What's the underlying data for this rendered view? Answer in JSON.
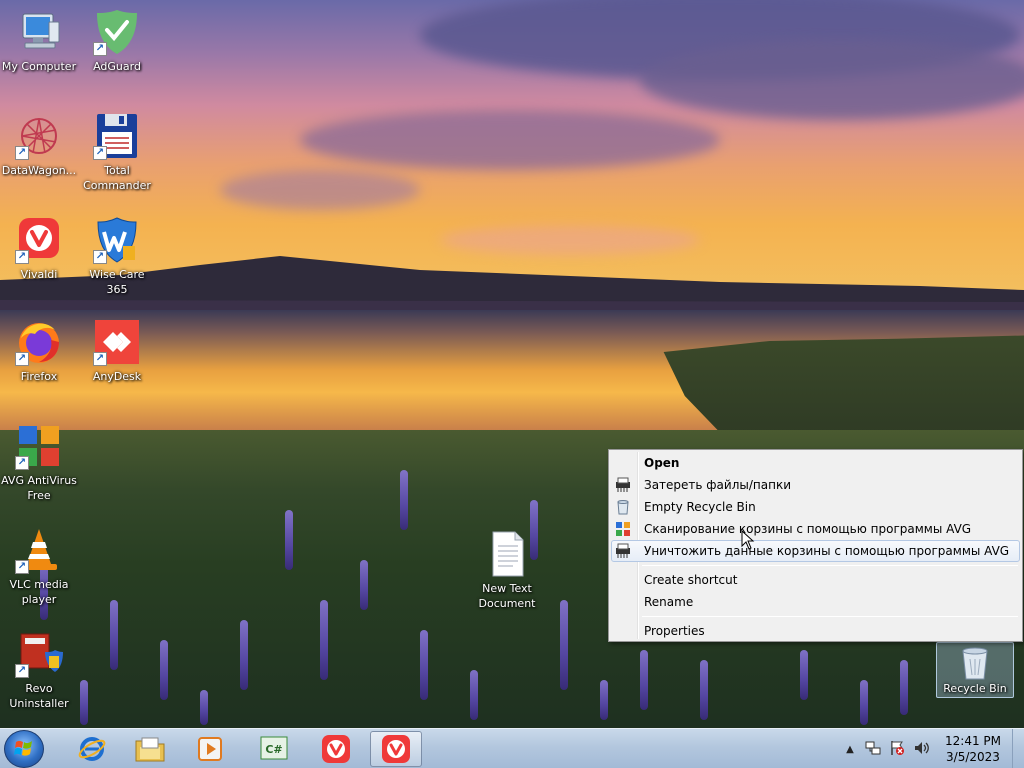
{
  "desktop_icons": [
    {
      "id": "my-computer",
      "label": "My Computer"
    },
    {
      "id": "adguard",
      "label": "AdGuard"
    },
    {
      "id": "datawagon",
      "label": "DataWagon..."
    },
    {
      "id": "total-commander",
      "label": "Total Commander"
    },
    {
      "id": "vivaldi",
      "label": "Vivaldi"
    },
    {
      "id": "wise-care",
      "label": "Wise Care 365"
    },
    {
      "id": "firefox",
      "label": "Firefox"
    },
    {
      "id": "anydesk",
      "label": "AnyDesk"
    },
    {
      "id": "avg",
      "label": "AVG AntiVirus Free"
    },
    {
      "id": "vlc",
      "label": "VLC media player"
    },
    {
      "id": "revo",
      "label": "Revo Uninstaller"
    },
    {
      "id": "new-text-document",
      "label": "New Text Document"
    },
    {
      "id": "recycle-bin",
      "label": "Recycle Bin"
    }
  ],
  "context_menu": {
    "items": [
      {
        "label": "Open",
        "bold": true
      },
      {
        "label": "Затереть файлы/папки"
      },
      {
        "label": "Empty Recycle Bin"
      },
      {
        "label": "Сканирование корзины с помощью программы AVG"
      },
      {
        "label": "Уничтожить данные корзины с помощью программы AVG",
        "highlighted": true
      },
      {
        "label": "Create shortcut"
      },
      {
        "label": "Rename"
      },
      {
        "label": "Properties"
      }
    ]
  },
  "taskbar": {
    "pinned": [
      {
        "name": "internet-explorer-icon"
      },
      {
        "name": "file-explorer-icon"
      },
      {
        "name": "media-player-icon"
      },
      {
        "name": "csharp-editor-icon"
      },
      {
        "name": "vivaldi-icon"
      },
      {
        "name": "vivaldi-icon",
        "active": true
      }
    ],
    "clock": {
      "time": "12:41 PM",
      "date": "3/5/2023"
    }
  },
  "colors": {
    "taskbar": "#b3c7de",
    "menu_bg": "#f0f0f0",
    "menu_highlight": "#e6edf7",
    "vivaldi_red": "#ef3939",
    "anydesk_red": "#ef443b",
    "adguard_green": "#68bc71"
  }
}
